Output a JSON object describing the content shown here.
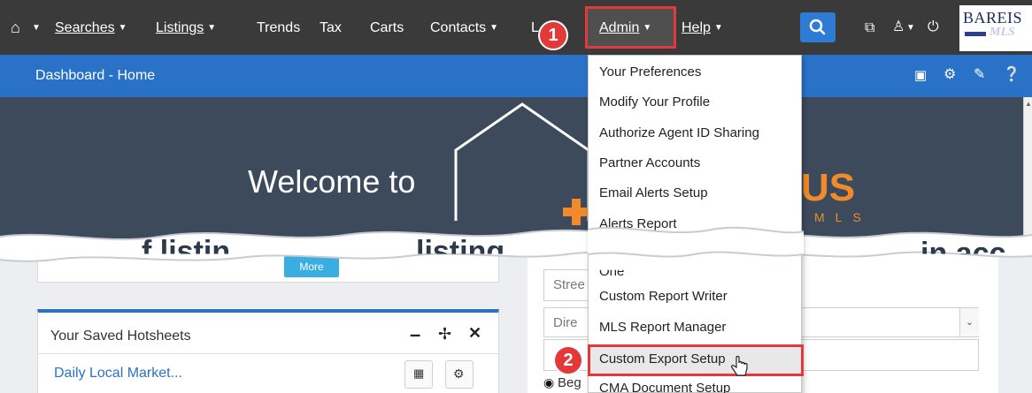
{
  "nav": {
    "searches": "Searches",
    "listings": "Listings",
    "trends": "Trends",
    "tax": "Tax",
    "carts": "Carts",
    "contacts": "Contacts",
    "l_partial": "L",
    "admin": "Admin",
    "help": "Help",
    "brand_top": "BAREIS",
    "brand_bottom": "MLS"
  },
  "bluebar": {
    "title": "Dashboard - Home"
  },
  "hero": {
    "welcome": "Welcome to",
    "brand_us": "US",
    "brand_mls": "MLS",
    "torn_text_left": "f listin",
    "torn_text_mid": "listing",
    "torn_text_right": "in acc",
    "more_button": "More"
  },
  "admin_menu": {
    "items": [
      "Your Preferences",
      "Modify Your Profile",
      "Authorize Agent ID Sharing",
      "Partner Accounts",
      "Email Alerts Setup",
      "Alerts Report",
      "One",
      "Custom Report Writer",
      "MLS Report Manager",
      "Custom Export Setup",
      "CMA Document Setup"
    ]
  },
  "hotsheets": {
    "title": "Your Saved Hotsheets",
    "row1": "Daily Local Market..."
  },
  "form": {
    "street_placeholder": "Stree",
    "direction_placeholder": "Dire",
    "radio_label": "Beg"
  },
  "badges": {
    "step1": "1",
    "step2": "2"
  },
  "colors": {
    "nav_bg": "#3a3a3a",
    "blue_bar": "#2a72c8",
    "highlight": "#e23a3a",
    "brand_orange": "#f08a2a",
    "link_blue": "#2a72c8"
  }
}
